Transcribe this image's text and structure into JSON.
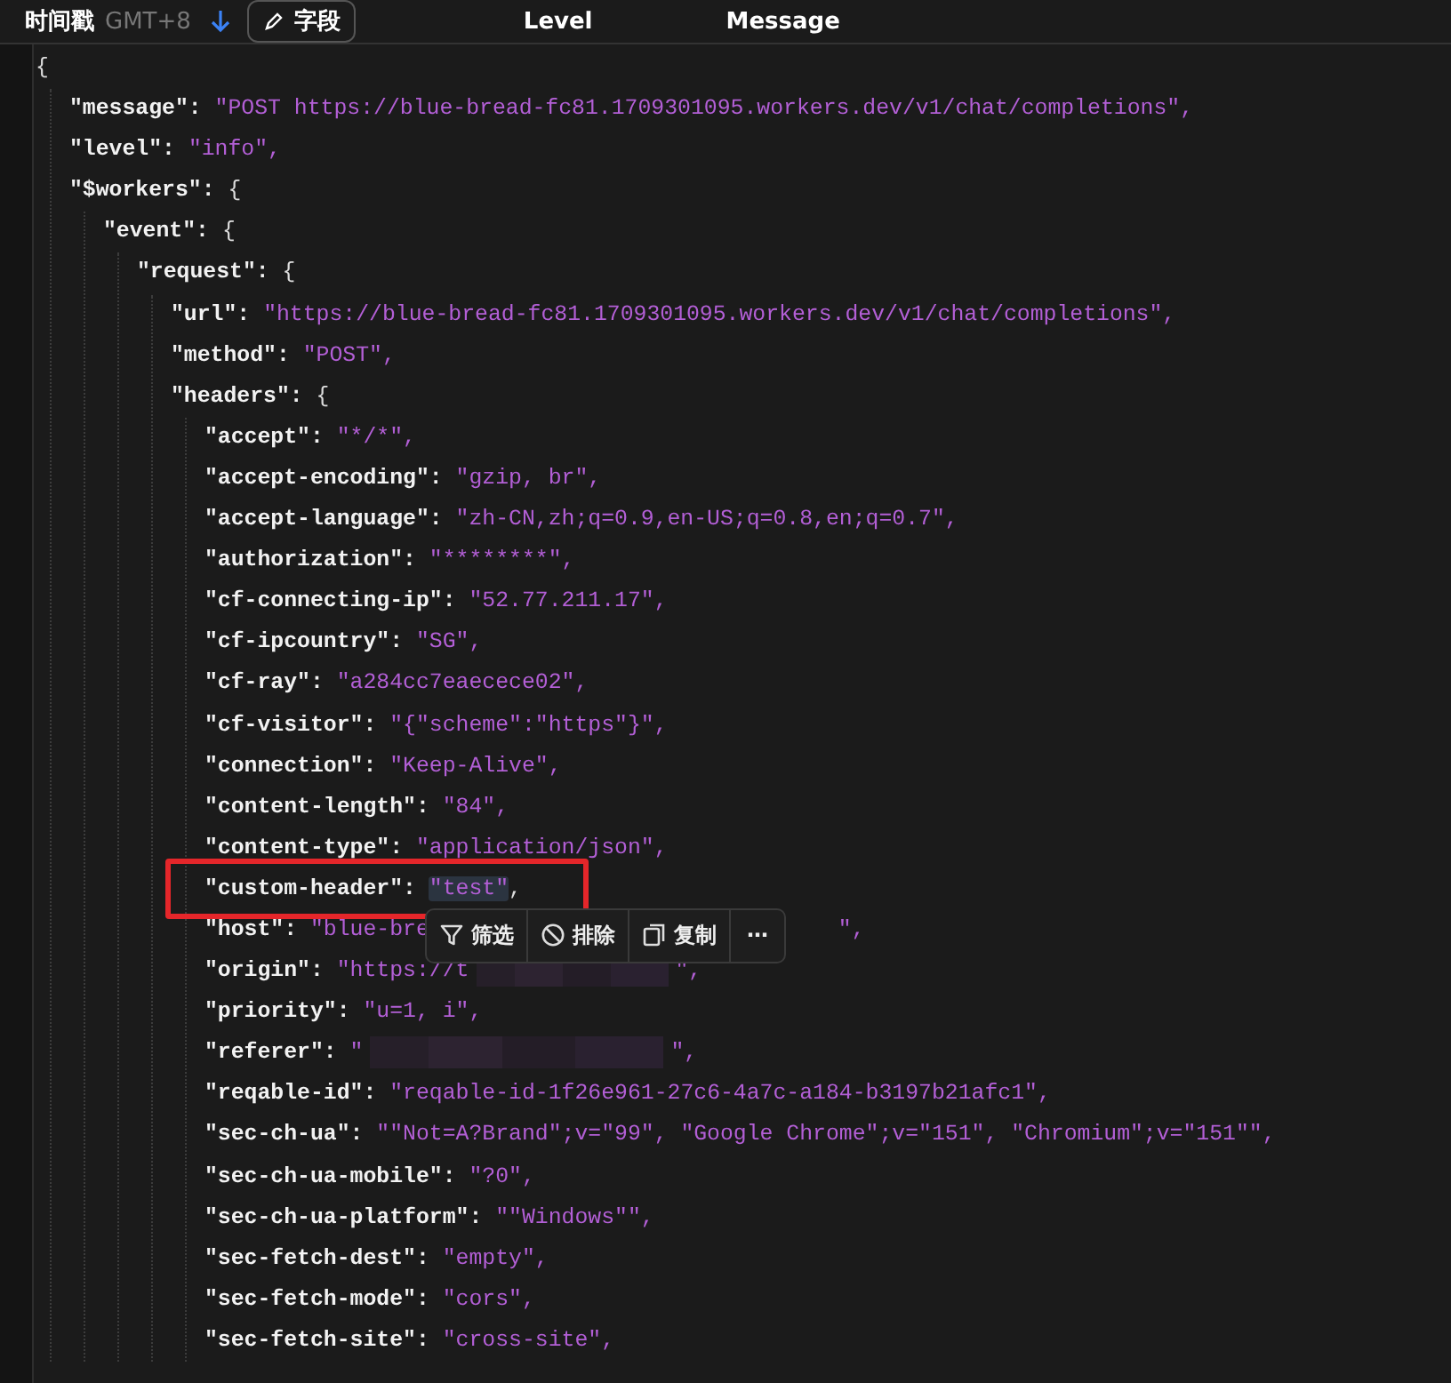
{
  "header": {
    "time_label": "时间戳",
    "timezone": "GMT+8",
    "fields_button": "字段",
    "columns": [
      "Level",
      "Message"
    ]
  },
  "document": {
    "open": "{",
    "children": [
      {
        "key": "\"message\":",
        "value": "\"POST https://blue-bread-fc81.1709301095.workers.dev/v1/chat/completions\","
      },
      {
        "key": "\"level\":",
        "value": "\"info\","
      },
      {
        "key": "\"$workers\":",
        "open": "{",
        "children": [
          {
            "key": "\"event\":",
            "open": "{",
            "children": [
              {
                "key": "\"request\":",
                "open": "{",
                "children": [
                  {
                    "key": "\"url\":",
                    "value": "\"https://blue-bread-fc81.1709301095.workers.dev/v1/chat/completions\","
                  },
                  {
                    "key": "\"method\":",
                    "value": "\"POST\","
                  },
                  {
                    "key": "\"headers\":",
                    "open": "{",
                    "children": [
                      {
                        "key": "\"accept\":",
                        "value": "\"*/*\",",
                        "kind": "plain",
                        "selected": false,
                        "boxed": false
                      },
                      {
                        "key": "\"accept-encoding\":",
                        "value": "\"gzip, br\",",
                        "kind": "plain",
                        "selected": false,
                        "boxed": false
                      },
                      {
                        "key": "\"accept-language\":",
                        "value": "\"zh-CN,zh;q=0.9,en-US;q=0.8,en;q=0.7\",",
                        "kind": "plain",
                        "selected": false,
                        "boxed": false
                      },
                      {
                        "key": "\"authorization\":",
                        "value": "\"********\",",
                        "kind": "plain",
                        "selected": false,
                        "boxed": false
                      },
                      {
                        "key": "\"cf-connecting-ip\":",
                        "value": "\"52.77.211.17\",",
                        "kind": "plain",
                        "selected": false,
                        "boxed": false
                      },
                      {
                        "key": "\"cf-ipcountry\":",
                        "value": "\"SG\",",
                        "kind": "plain",
                        "selected": false,
                        "boxed": false
                      },
                      {
                        "key": "\"cf-ray\":",
                        "value": "\"a284cc7eaecece02\",",
                        "kind": "plain",
                        "selected": false,
                        "boxed": false
                      },
                      {
                        "key": "\"cf-visitor\":",
                        "value": "\"{\"scheme\":\"https\"}\",",
                        "kind": "plain",
                        "selected": false,
                        "boxed": false
                      },
                      {
                        "key": "\"connection\":",
                        "value": "\"Keep-Alive\",",
                        "kind": "plain",
                        "selected": false,
                        "boxed": false
                      },
                      {
                        "key": "\"content-length\":",
                        "value": "\"84\",",
                        "kind": "plain",
                        "selected": false,
                        "boxed": false
                      },
                      {
                        "key": "\"content-type\":",
                        "value": "\"application/json\",",
                        "kind": "plain",
                        "selected": false,
                        "boxed": false
                      },
                      {
                        "key": "\"custom-header\":",
                        "value": "\"test\"",
                        "tail": ",",
                        "kind": "plain",
                        "selected": true,
                        "boxed": true
                      },
                      {
                        "key": "\"host\":",
                        "value": "\"blue-bre",
                        "tail": "\",",
                        "kind": "covered",
                        "selected": false,
                        "boxed": false
                      },
                      {
                        "key": "\"origin\":",
                        "value": "\"https://t",
                        "tail": "\",",
                        "kind": "redacted",
                        "selected": false,
                        "boxed": false
                      },
                      {
                        "key": "\"priority\":",
                        "value": "\"u=1, i\",",
                        "kind": "plain",
                        "selected": false,
                        "boxed": false
                      },
                      {
                        "key": "\"referer\":",
                        "value": "\"",
                        "tail": "\",",
                        "kind": "redacted",
                        "selected": false,
                        "boxed": false
                      },
                      {
                        "key": "\"reqable-id\":",
                        "value": "\"reqable-id-1f26e961-27c6-4a7c-a184-b3197b21afc1\",",
                        "kind": "plain",
                        "selected": false,
                        "boxed": false
                      },
                      {
                        "key": "\"sec-ch-ua\":",
                        "value": "\"\"Not=A?Brand\";v=\"99\", \"Google Chrome\";v=\"151\", \"Chromium\";v=\"151\"\",",
                        "kind": "plain",
                        "selected": false,
                        "boxed": false
                      },
                      {
                        "key": "\"sec-ch-ua-mobile\":",
                        "value": "\"?0\",",
                        "kind": "plain",
                        "selected": false,
                        "boxed": false
                      },
                      {
                        "key": "\"sec-ch-ua-platform\":",
                        "value": "\"\"Windows\"\",",
                        "kind": "plain",
                        "selected": false,
                        "boxed": false
                      },
                      {
                        "key": "\"sec-fetch-dest\":",
                        "value": "\"empty\",",
                        "kind": "plain",
                        "selected": false,
                        "boxed": false
                      },
                      {
                        "key": "\"sec-fetch-mode\":",
                        "value": "\"cors\",",
                        "kind": "plain",
                        "selected": false,
                        "boxed": false
                      },
                      {
                        "key": "\"sec-fetch-site\":",
                        "value": "\"cross-site\",",
                        "kind": "plain",
                        "selected": false,
                        "boxed": false
                      }
                    ]
                  }
                ]
              }
            ]
          }
        ]
      }
    ]
  },
  "context_menu": [
    {
      "kind": "filter",
      "label": "筛选"
    },
    {
      "kind": "exclude",
      "label": "排除"
    },
    {
      "kind": "copy",
      "label": "复制"
    },
    {
      "kind": "more",
      "label": "⋯"
    }
  ]
}
